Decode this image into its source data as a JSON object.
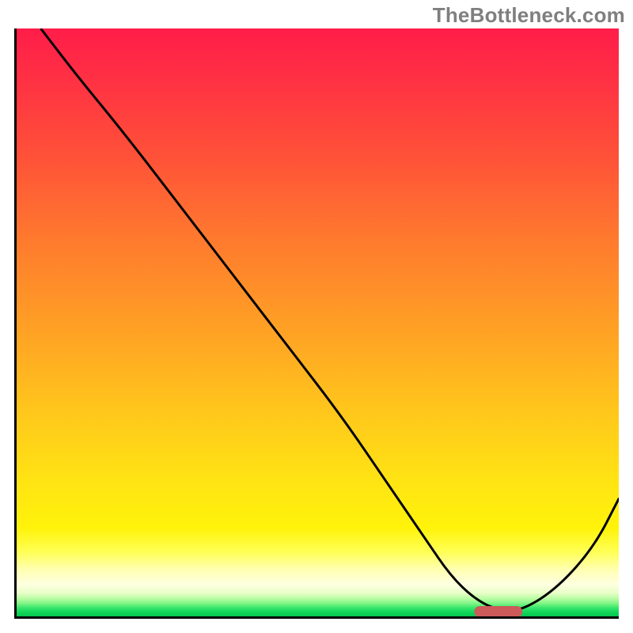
{
  "watermark": "TheBottleneck.com",
  "chart_data": {
    "type": "line",
    "title": "",
    "xlabel": "",
    "ylabel": "",
    "xlim": [
      0,
      100
    ],
    "ylim": [
      0,
      100
    ],
    "grid": false,
    "series": [
      {
        "name": "bottleneck-curve",
        "x": [
          4,
          10,
          18,
          27,
          36,
          45,
          54,
          62,
          68,
          72,
          76,
          80,
          84,
          90,
          96,
          100
        ],
        "y": [
          100,
          92,
          82,
          70,
          58,
          46,
          34,
          22,
          13,
          7,
          3,
          1,
          1,
          5,
          12,
          20
        ]
      }
    ],
    "marker": {
      "name": "optimal-range-pill",
      "x_start": 76,
      "x_end": 84,
      "y": 0.8,
      "color": "#cc5a59"
    },
    "background_gradient": {
      "stops": [
        {
          "pos": 0.0,
          "color": "#ff1d49"
        },
        {
          "pos": 0.52,
          "color": "#ffa324"
        },
        {
          "pos": 0.85,
          "color": "#fff30a"
        },
        {
          "pos": 0.95,
          "color": "#feffe0"
        },
        {
          "pos": 1.0,
          "color": "#06c750"
        }
      ]
    }
  }
}
